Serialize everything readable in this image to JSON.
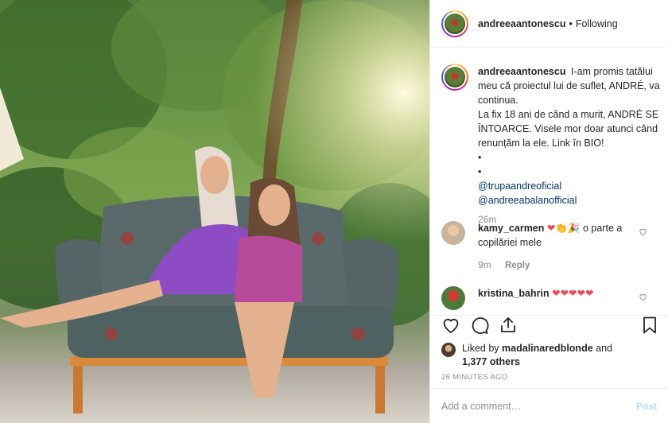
{
  "post": {
    "username": "andreeaantonescu",
    "separator": "•",
    "follow_status": "Following"
  },
  "caption": {
    "username": "andreeaantonescu",
    "text": "I-am promis tatălui meu că proiectul lui de suflet, ANDRÉ, va continua.",
    "text2": "La fix 18 ani de când a murit, ANDRÉ SE ÎNTOARCE. Visele mor doar atunci când renunțăm la ele. Link în BIO!",
    "bullet1": "•",
    "bullet2": "•",
    "mention1": "@trupaandreoficial",
    "mention2": "@andreeabalanofficial",
    "age": "26m"
  },
  "comments": [
    {
      "username": "kamy_carmen",
      "emojis": "❤👏🎉",
      "text": "o parte a copilăriei mele",
      "age": "9m",
      "reply_label": "Reply"
    },
    {
      "username": "kristina_bahrin",
      "emojis": "❤❤❤❤❤"
    }
  ],
  "likes": {
    "prefix": "Liked by",
    "user": "madalinaredblonde",
    "and": "and",
    "others": "1,377 others"
  },
  "timestamp": "26 MINUTES AGO",
  "add_comment": {
    "placeholder": "Add a comment…",
    "post_label": "Post"
  },
  "colors": {
    "heart_red": "#ed4956",
    "link_blue": "#003569",
    "post_disabled": "#b3dbff"
  },
  "icons": [
    "heart-icon",
    "comment-icon",
    "share-icon",
    "bookmark-icon",
    "small-heart-icon"
  ]
}
